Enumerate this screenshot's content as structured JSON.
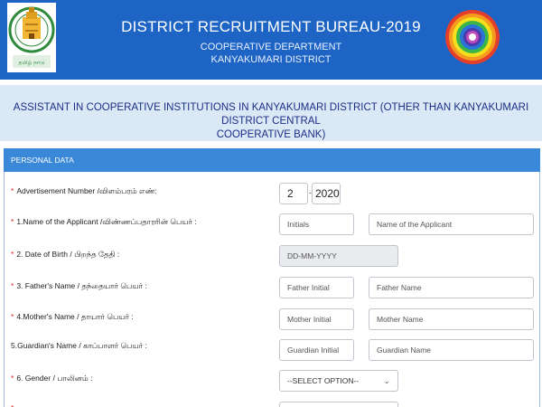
{
  "header": {
    "title": "DISTRICT RECRUITMENT BUREAU-2019",
    "sub1": "COOPERATIVE DEPARTMENT",
    "sub2": "KANYAKUMARI DISTRICT",
    "left_logo": "tamil-nadu-emblem",
    "right_logo": "cooperative-rainbow-emblem"
  },
  "band": {
    "line1": "ASSISTANT IN COOPERATIVE INSTITUTIONS IN KANYAKUMARI DISTRICT (OTHER THAN KANYAKUMARI DISTRICT CENTRAL",
    "line2": "COOPERATIVE BANK)"
  },
  "panel": {
    "title": "PERSONAL DATA"
  },
  "form": {
    "adv": {
      "star": "*",
      "label": "Advertisement Number /விளம்பரம் எண்:",
      "num": "2",
      "dash": "-",
      "year": "2020"
    },
    "name": {
      "star": "*",
      "label": "1.Name of the Applicant /விண்ணப்பதாரரின் பெயர் :",
      "initials_ph": "Initials",
      "name_ph": "Name of the Applicant"
    },
    "dob": {
      "star": "*",
      "label": "2. Date of Birth / பிறந்த தேதி :",
      "placeholder": "DD-MM-YYYY"
    },
    "father": {
      "star": "*",
      "label": "3. Father's Name / தந்தையார் பெயர் :",
      "initial_ph": "Father Initial",
      "name_ph": "Father Name"
    },
    "mother": {
      "star": "*",
      "label": "4.Mother's Name / தாயார் பெயர் :",
      "initial_ph": "Mother Initial",
      "name_ph": "Mother Name"
    },
    "guardian": {
      "label": "5.Guardian's Name / காப்பாளர் பெயர் :",
      "initial_ph": "Guardian  Initial",
      "name_ph": "Guardian  Name"
    },
    "gender": {
      "star": "*",
      "label": "6. Gender / பாலினம் :",
      "selected": "--SELECT OPTION--"
    }
  },
  "colors": {
    "header_bg": "#1d64c4",
    "band_bg": "#dbe9f7",
    "panel_head": "#3a88d8",
    "required": "#d9262b"
  }
}
